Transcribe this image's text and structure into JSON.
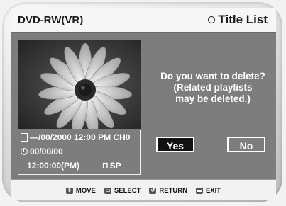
{
  "header": {
    "device_label": "DVD-RW(VR)",
    "screen_title": "Title List"
  },
  "info": {
    "date_line": "—/00/2000 12:00 PM CH0",
    "date2": "00/00/00",
    "time": "12:00:00(PM)",
    "mode": "SP"
  },
  "dialog": {
    "line1": "Do you want to delete?",
    "line2": "(Related playlists",
    "line3": "may be deleted.)",
    "yes_label": "Yes",
    "no_label": "No"
  },
  "footer": {
    "move": "MOVE",
    "select": "SELECT",
    "return": "RETURN",
    "exit": "EXIT"
  },
  "icons": {
    "title_list": "circle-icon",
    "record_info": "document-icon",
    "clock": "clock-icon",
    "lock": "unlock-icon",
    "move": "up-down-icon",
    "select": "enter-icon",
    "return": "return-icon",
    "exit": "exit-icon"
  }
}
